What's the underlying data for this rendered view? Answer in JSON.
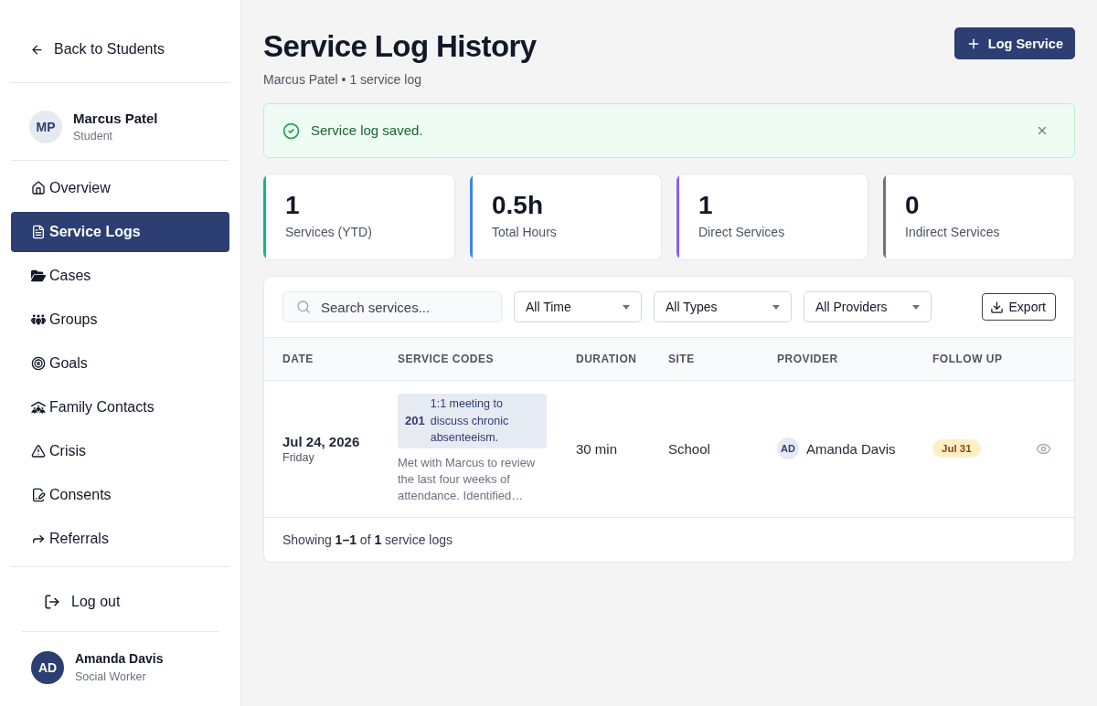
{
  "sidebar": {
    "back_link": "Back to Students",
    "student": {
      "initials": "MP",
      "name": "Marcus Patel",
      "role": "Student"
    },
    "nav_items": [
      {
        "label": "Overview",
        "selected": false
      },
      {
        "label": "Service Logs",
        "selected": true
      },
      {
        "label": "Cases",
        "selected": false
      },
      {
        "label": "Groups",
        "selected": false
      },
      {
        "label": "Goals",
        "selected": false
      },
      {
        "label": "Family Contacts",
        "selected": false
      },
      {
        "label": "Crisis",
        "selected": false
      },
      {
        "label": "Consents",
        "selected": false
      },
      {
        "label": "Referrals",
        "selected": false
      }
    ],
    "logout": "Log out",
    "user": {
      "initials": "AD",
      "name": "Amanda Davis",
      "role": "Social Worker"
    }
  },
  "header": {
    "title": "Service Log History",
    "subtitle": "Marcus Patel • 1 service log",
    "primary_button": "Log Service"
  },
  "alert": {
    "message": "Service log saved."
  },
  "stats": [
    {
      "value": "1",
      "label": "Services (YTD)",
      "color": "#10b981"
    },
    {
      "value": "0.5h",
      "label": "Total Hours",
      "color": "#3b82f6"
    },
    {
      "value": "1",
      "label": "Direct Services",
      "color": "#8b5cf6"
    },
    {
      "value": "0",
      "label": "Indirect Services",
      "color": "#6b7280"
    }
  ],
  "filters": {
    "search_placeholder": "Search services...",
    "selects": [
      "All Time",
      "All Types",
      "All Providers"
    ],
    "export_button": "Export"
  },
  "table": {
    "columns": [
      "DATE",
      "SERVICE CODES",
      "DURATION",
      "SITE",
      "PROVIDER",
      "FOLLOW UP"
    ],
    "rows": [
      {
        "date": "Jul 24, 2026",
        "weekday": "Friday",
        "service_codes": [
          {
            "code": "201",
            "description": "1:1 meeting to discuss chronic absenteeism."
          }
        ],
        "notes": "Met with Marcus to review the last four weeks of attendance. Identified…",
        "duration": "30 min",
        "site": "School",
        "provider": {
          "initials": "AD",
          "name": "Amanda Davis"
        },
        "follow_up": "Jul 31"
      }
    ]
  },
  "footer": "Showing **1–1** of **1** service logs"
}
